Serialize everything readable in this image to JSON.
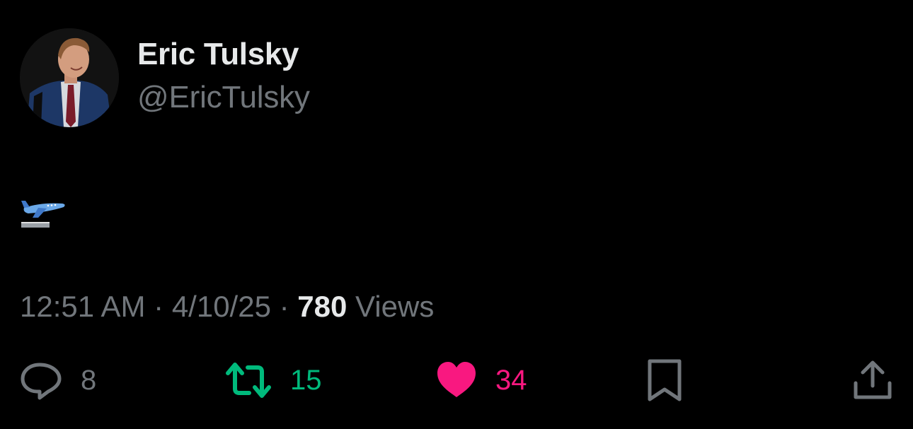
{
  "author": {
    "display_name": "Eric Tulsky",
    "handle": "@EricTulsky",
    "avatar_icon": "profile-photo"
  },
  "post": {
    "content_emoji": "airplane-departure-emoji"
  },
  "meta": {
    "time": "12:51 AM",
    "separator": "·",
    "date": "4/10/25",
    "views_count": "780",
    "views_label": "Views"
  },
  "actions": {
    "reply": {
      "icon": "reply-icon",
      "count": "8"
    },
    "retweet": {
      "icon": "retweet-icon",
      "count": "15",
      "color": "#00ba7c"
    },
    "like": {
      "icon": "heart-icon",
      "count": "34",
      "color": "#f91880"
    },
    "bookmark": {
      "icon": "bookmark-icon"
    },
    "share": {
      "icon": "share-icon"
    }
  },
  "colors": {
    "background": "#000000",
    "primary_text": "#e7e9ea",
    "secondary_text": "#71767b"
  }
}
